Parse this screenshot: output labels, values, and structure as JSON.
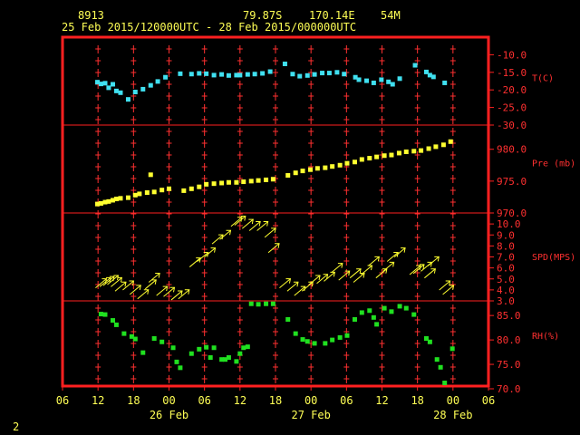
{
  "header": {
    "station": "8913",
    "lat": "79.87S",
    "lon": "170.14E",
    "elev": "54M",
    "period": "25 Feb 2015/120000UTC - 28 Feb 2015/000000UTC",
    "page": "2"
  },
  "colors": {
    "frame": "#ff2020",
    "tick": "#ff3030",
    "label": "#ff3030",
    "header": "#ffff55",
    "temp": "#40e0f0",
    "pressure": "#ffff30",
    "wind": "#ffff30",
    "rh": "#20e020",
    "bg": "#000000"
  },
  "chart_data": {
    "type": "scatter",
    "x_unit": "hours since 25 Feb 00 UTC",
    "x_range": [
      6,
      78
    ],
    "x_ticks": [
      "06",
      "12",
      "18",
      "00",
      "06",
      "12",
      "18",
      "00",
      "06",
      "12",
      "18",
      "00",
      "06"
    ],
    "date_labels": [
      "26 Feb",
      "27 Feb",
      "28 Feb"
    ],
    "panels": [
      {
        "key": "temp",
        "label": "T(C)",
        "ylim": [
          -30,
          -5
        ],
        "ticks": [
          -30,
          -25,
          -20,
          -15,
          -10
        ],
        "tick_labels": [
          "-30.0",
          "-25.0",
          "-20.0",
          "-15.0",
          "-10.0"
        ],
        "points": [
          [
            11.9,
            -17.8
          ],
          [
            12.5,
            -18.3
          ],
          [
            13.2,
            -18.1
          ],
          [
            13.8,
            -19.4
          ],
          [
            14.5,
            -18.4
          ],
          [
            15.1,
            -20.3
          ],
          [
            15.8,
            -20.8
          ],
          [
            17.1,
            -22.7
          ],
          [
            18.3,
            -20.6
          ],
          [
            19.6,
            -19.8
          ],
          [
            20.9,
            -18.7
          ],
          [
            22.1,
            -17.6
          ],
          [
            23.4,
            -16.4
          ],
          [
            25.9,
            -15.4
          ],
          [
            27.8,
            -15.5
          ],
          [
            29.1,
            -15.3
          ],
          [
            30.3,
            -15.4
          ],
          [
            31.6,
            -15.8
          ],
          [
            32.9,
            -15.6
          ],
          [
            34.1,
            -15.9
          ],
          [
            35.4,
            -15.8
          ],
          [
            36.0,
            -15.8
          ],
          [
            37.3,
            -15.6
          ],
          [
            38.5,
            -15.5
          ],
          [
            39.8,
            -15.3
          ],
          [
            41.1,
            -14.8
          ],
          [
            43.6,
            -12.6
          ],
          [
            44.9,
            -15.5
          ],
          [
            46.1,
            -16.1
          ],
          [
            47.4,
            -15.9
          ],
          [
            48.6,
            -15.6
          ],
          [
            49.9,
            -15.2
          ],
          [
            51.1,
            -15.2
          ],
          [
            52.4,
            -15.0
          ],
          [
            53.6,
            -15.5
          ],
          [
            55.5,
            -16.4
          ],
          [
            56.1,
            -17.1
          ],
          [
            57.4,
            -17.4
          ],
          [
            58.6,
            -18.0
          ],
          [
            59.9,
            -17.1
          ],
          [
            61.1,
            -17.7
          ],
          [
            61.8,
            -18.4
          ],
          [
            63.0,
            -16.8
          ],
          [
            65.6,
            -13.0
          ],
          [
            67.5,
            -14.9
          ],
          [
            68.1,
            -15.8
          ],
          [
            68.7,
            -16.3
          ],
          [
            70.6,
            -18.0
          ]
        ]
      },
      {
        "key": "pressure",
        "label": "Pre (mb)",
        "ylim": [
          970,
          983.8
        ],
        "ticks": [
          970,
          975,
          980
        ],
        "tick_labels": [
          "970.0",
          "975.0",
          "980.0"
        ],
        "points": [
          [
            11.9,
            971.4
          ],
          [
            12.5,
            971.5
          ],
          [
            13.2,
            971.7
          ],
          [
            13.8,
            971.8
          ],
          [
            14.5,
            972.0
          ],
          [
            15.1,
            972.2
          ],
          [
            15.8,
            972.3
          ],
          [
            17.1,
            972.4
          ],
          [
            18.3,
            972.8
          ],
          [
            19.0,
            973.0
          ],
          [
            20.3,
            973.2
          ],
          [
            20.9,
            976.0
          ],
          [
            21.5,
            973.3
          ],
          [
            22.8,
            973.6
          ],
          [
            24.0,
            973.8
          ],
          [
            26.5,
            973.5
          ],
          [
            27.8,
            973.8
          ],
          [
            29.1,
            974.1
          ],
          [
            30.3,
            974.5
          ],
          [
            31.6,
            974.6
          ],
          [
            32.9,
            974.7
          ],
          [
            34.1,
            974.8
          ],
          [
            35.4,
            974.8
          ],
          [
            36.6,
            974.9
          ],
          [
            37.9,
            975.0
          ],
          [
            39.1,
            975.1
          ],
          [
            40.4,
            975.2
          ],
          [
            41.6,
            975.3
          ],
          [
            44.1,
            975.9
          ],
          [
            45.4,
            976.3
          ],
          [
            46.6,
            976.6
          ],
          [
            47.9,
            976.8
          ],
          [
            49.1,
            977.0
          ],
          [
            50.4,
            977.1
          ],
          [
            51.6,
            977.3
          ],
          [
            52.9,
            977.5
          ],
          [
            54.1,
            977.8
          ],
          [
            55.4,
            978.0
          ],
          [
            56.6,
            978.4
          ],
          [
            57.9,
            978.6
          ],
          [
            59.1,
            978.8
          ],
          [
            60.4,
            979.0
          ],
          [
            61.6,
            979.1
          ],
          [
            62.9,
            979.4
          ],
          [
            64.1,
            979.6
          ],
          [
            65.4,
            979.7
          ],
          [
            66.6,
            979.8
          ],
          [
            67.9,
            980.1
          ],
          [
            69.1,
            980.4
          ],
          [
            70.4,
            980.7
          ],
          [
            71.6,
            981.2
          ]
        ]
      },
      {
        "key": "wind",
        "label": "SPD(MPS)",
        "ylim": [
          3,
          11
        ],
        "ticks": [
          3,
          4,
          5,
          6,
          7,
          8,
          9,
          10
        ],
        "tick_labels": [
          "3.0",
          "4.0",
          "5.0",
          "6.0",
          "7.0",
          "8.0",
          "9.0",
          "10.0"
        ],
        "points": [
          [
            12.5,
            4.6
          ],
          [
            13.2,
            4.7
          ],
          [
            13.8,
            4.8
          ],
          [
            14.5,
            4.9
          ],
          [
            15.1,
            4.7
          ],
          [
            15.8,
            4.3
          ],
          [
            17.1,
            4.4
          ],
          [
            18.3,
            4.0
          ],
          [
            19.6,
            3.6
          ],
          [
            20.9,
            4.5
          ],
          [
            21.5,
            5.1
          ],
          [
            22.8,
            3.9
          ],
          [
            24.0,
            3.8
          ],
          [
            25.3,
            3.5
          ],
          [
            26.5,
            3.6
          ],
          [
            28.4,
            6.5
          ],
          [
            29.7,
            7.0
          ],
          [
            30.9,
            7.4
          ],
          [
            32.2,
            8.6
          ],
          [
            33.5,
            9.0
          ],
          [
            35.4,
            10.2
          ],
          [
            36.0,
            10.3
          ],
          [
            37.3,
            10.0
          ],
          [
            38.5,
            9.8
          ],
          [
            39.8,
            9.8
          ],
          [
            41.1,
            9.2
          ],
          [
            41.7,
            7.8
          ],
          [
            43.6,
            4.6
          ],
          [
            44.9,
            4.3
          ],
          [
            46.1,
            3.9
          ],
          [
            47.4,
            4.3
          ],
          [
            48.6,
            4.9
          ],
          [
            49.9,
            5.0
          ],
          [
            51.1,
            5.2
          ],
          [
            52.4,
            6.0
          ],
          [
            53.6,
            5.3
          ],
          [
            55.5,
            5.5
          ],
          [
            56.1,
            5.1
          ],
          [
            57.4,
            5.8
          ],
          [
            58.6,
            6.6
          ],
          [
            59.9,
            5.5
          ],
          [
            61.1,
            6.1
          ],
          [
            61.8,
            7.0
          ],
          [
            63.0,
            7.4
          ],
          [
            65.6,
            5.8
          ],
          [
            66.2,
            5.9
          ],
          [
            67.5,
            6.1
          ],
          [
            68.1,
            5.5
          ],
          [
            68.7,
            6.6
          ],
          [
            70.6,
            4.4
          ],
          [
            71.2,
            4.0
          ]
        ]
      },
      {
        "key": "rh",
        "label": "RH(%)",
        "ylim": [
          70,
          88
        ],
        "ticks": [
          70,
          75,
          80,
          85
        ],
        "tick_labels": [
          "70.0",
          "75.0",
          "80.0",
          "85.0"
        ],
        "points": [
          [
            12.5,
            85.3
          ],
          [
            13.2,
            85.2
          ],
          [
            14.5,
            84.0
          ],
          [
            15.1,
            83.1
          ],
          [
            16.4,
            81.3
          ],
          [
            17.7,
            80.7
          ],
          [
            18.3,
            80.2
          ],
          [
            19.6,
            77.4
          ],
          [
            21.5,
            80.3
          ],
          [
            22.8,
            79.6
          ],
          [
            24.7,
            78.4
          ],
          [
            25.3,
            75.5
          ],
          [
            25.9,
            74.3
          ],
          [
            27.8,
            77.2
          ],
          [
            29.1,
            78.1
          ],
          [
            30.3,
            78.5
          ],
          [
            31.0,
            76.4
          ],
          [
            31.6,
            78.4
          ],
          [
            32.9,
            76.0
          ],
          [
            33.5,
            76.0
          ],
          [
            34.1,
            76.4
          ],
          [
            35.4,
            75.6
          ],
          [
            36.0,
            77.2
          ],
          [
            36.6,
            78.4
          ],
          [
            37.3,
            78.6
          ],
          [
            37.9,
            87.4
          ],
          [
            39.1,
            87.3
          ],
          [
            40.4,
            87.4
          ],
          [
            41.6,
            87.4
          ],
          [
            44.1,
            84.2
          ],
          [
            45.4,
            81.3
          ],
          [
            46.6,
            80.1
          ],
          [
            47.4,
            79.7
          ],
          [
            48.6,
            79.3
          ],
          [
            50.4,
            79.3
          ],
          [
            51.6,
            80.0
          ],
          [
            52.9,
            80.5
          ],
          [
            54.1,
            80.9
          ],
          [
            55.4,
            84.2
          ],
          [
            56.6,
            85.6
          ],
          [
            57.9,
            86.0
          ],
          [
            58.6,
            84.6
          ],
          [
            59.1,
            83.2
          ],
          [
            60.4,
            86.5
          ],
          [
            61.6,
            85.8
          ],
          [
            63.0,
            86.9
          ],
          [
            64.1,
            86.5
          ],
          [
            65.4,
            85.2
          ],
          [
            67.5,
            80.3
          ],
          [
            68.1,
            79.6
          ],
          [
            69.3,
            76.0
          ],
          [
            69.9,
            74.4
          ],
          [
            70.6,
            71.2
          ],
          [
            71.9,
            78.2
          ]
        ]
      }
    ]
  }
}
